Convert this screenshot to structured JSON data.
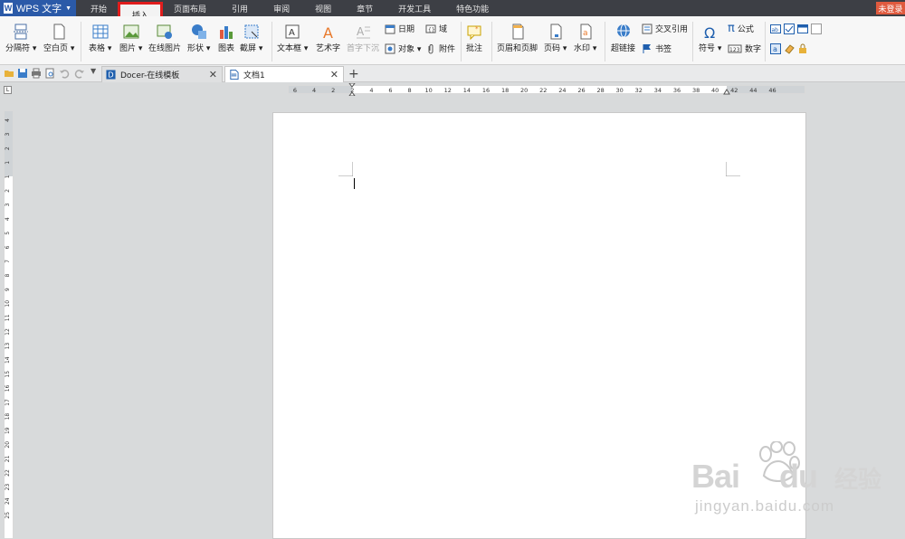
{
  "menubar": {
    "app_name": "WPS 文字",
    "tabs": [
      "开始",
      "插入",
      "页面布局",
      "引用",
      "审阅",
      "视图",
      "章节",
      "开发工具",
      "特色功能"
    ],
    "active_tab": "插入",
    "login": "未登录"
  },
  "ribbon": {
    "page_break": "分隔符",
    "blank_page": "空白页",
    "table": "表格",
    "picture": "图片",
    "online_picture": "在线图片",
    "shape": "形状",
    "chart": "图表",
    "screenshot": "截屏",
    "text_box": "文本框",
    "word_art": "艺术字",
    "drop_cap": "首字下沉",
    "date": "日期",
    "field": "域",
    "object": "对象",
    "attachment": "附件",
    "comment": "批注",
    "header_footer": "页眉和页脚",
    "page_number": "页码",
    "watermark": "水印",
    "hyperlink": "超链接",
    "cross_reference": "交叉引用",
    "bookmark": "书签",
    "symbol": "符号",
    "formula": "公式",
    "number": "数字"
  },
  "tabs": {
    "docer": "Docer-在线模板",
    "doc1": "文档1",
    "new_tab": "+"
  },
  "ruler": {
    "h_ticks": [
      "6",
      "4",
      "2",
      "2",
      "4",
      "6",
      "8",
      "10",
      "12",
      "14",
      "16",
      "18",
      "20",
      "22",
      "24",
      "26",
      "28",
      "30",
      "32",
      "34",
      "36",
      "38",
      "40",
      "42",
      "44",
      "46"
    ],
    "v_ticks": [
      "4",
      "3",
      "2",
      "1",
      "1",
      "2",
      "3",
      "4",
      "5",
      "6",
      "7",
      "8",
      "9",
      "10",
      "11",
      "12",
      "13",
      "14",
      "15",
      "16",
      "17",
      "18",
      "19",
      "20",
      "21",
      "22",
      "23",
      "24",
      "25"
    ],
    "corner": "L"
  },
  "watermark": {
    "brand": "Bai",
    "brand2": "du",
    "cn": "经验",
    "url": "jingyan.baidu.com"
  },
  "colors": {
    "menubar": "#3d3f45",
    "app_button": "#2b5aa8",
    "highlight_box": "#e01d1d",
    "login": "#e05a3e"
  }
}
